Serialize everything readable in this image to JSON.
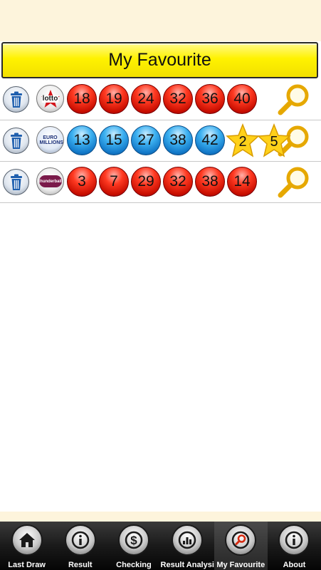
{
  "header": {
    "title": "My Favourite"
  },
  "favourites": [
    {
      "lottery_logo_text": "lotto",
      "main_balls": [
        "18",
        "19",
        "24",
        "32",
        "36",
        "40"
      ],
      "main_color": "red",
      "extra_balls": []
    },
    {
      "lottery_logo_text": "EURO MILLIONS",
      "main_balls": [
        "13",
        "15",
        "27",
        "38",
        "42"
      ],
      "main_color": "blue",
      "extra_balls": [
        "2",
        "5"
      ]
    },
    {
      "lottery_logo_text": "thunderball",
      "main_balls": [
        "3",
        "7",
        "29",
        "32",
        "38"
      ],
      "main_color": "red",
      "extra_balls": [
        "14"
      ]
    }
  ],
  "tabs": [
    {
      "label": "Last Draw",
      "icon": "home-icon"
    },
    {
      "label": "Result",
      "icon": "info-icon"
    },
    {
      "label": "Checking",
      "icon": "dollar-icon"
    },
    {
      "label": "Result Analysis",
      "icon": "bar-chart-icon"
    },
    {
      "label": "My Favourite",
      "icon": "search-icon",
      "active": true
    },
    {
      "label": "About",
      "icon": "info-icon"
    }
  ],
  "colors": {
    "title_bar": "#fff200",
    "cream": "#fdf4dc",
    "red_ball": "#e01a0a",
    "blue_ball": "#1a8ad8",
    "star": "#ffd11a",
    "magnifier": "#f0b400"
  }
}
